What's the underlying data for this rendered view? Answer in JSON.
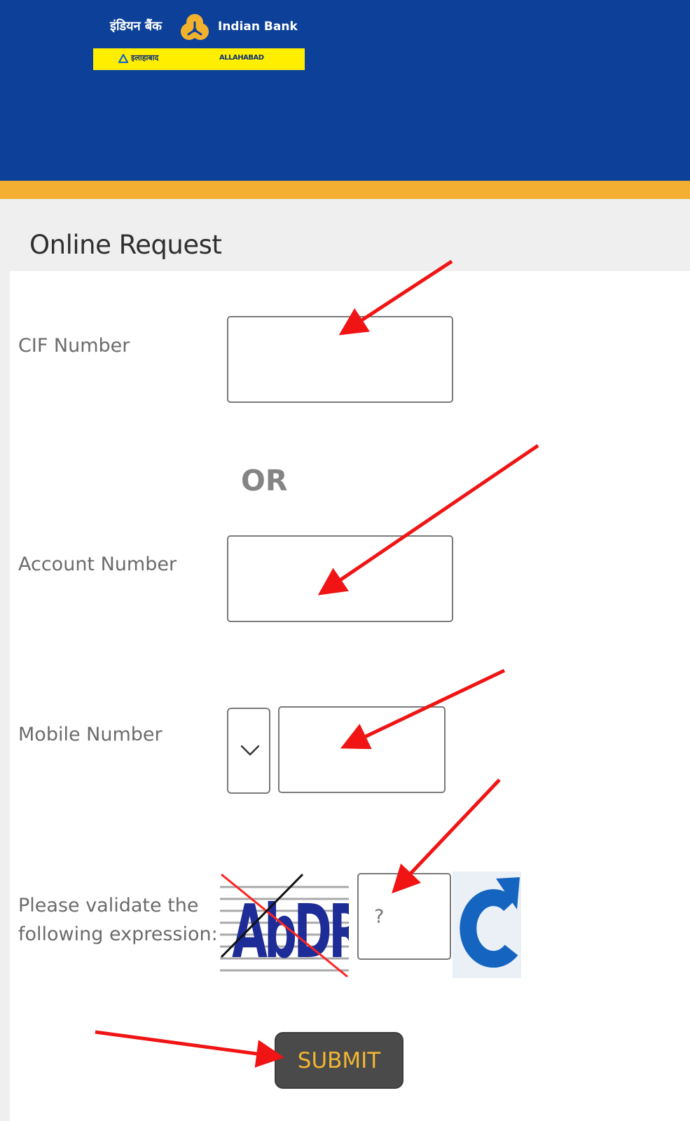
{
  "theme": {
    "brand": "#0d4199",
    "accent": "#f2af32",
    "annotation": "#f01414"
  },
  "header": {
    "logo": {
      "hindi_name": "इंडियन बैंक",
      "english_name": "Indian Bank",
      "band_hindi": "इलाहाबाद",
      "band_english": "ALLAHABAD",
      "mark_icon": "indian-bank-logo-icon"
    }
  },
  "page": {
    "title": "Online Request"
  },
  "form": {
    "cif_label": "CIF Number",
    "cif_value": "",
    "or_text": "OR",
    "account_label": "Account Number",
    "account_value": "",
    "mobile_label": "Mobile Number",
    "country_code_icon": "chevron-down-icon",
    "mobile_value": "",
    "captcha_label_line1": "Please validate the",
    "captcha_label_line2": "following expression:",
    "captcha_text": "AbDRSh",
    "captcha_answer_placeholder": "?",
    "refresh_icon": "refresh-icon",
    "submit_label": "SUBMIT"
  }
}
